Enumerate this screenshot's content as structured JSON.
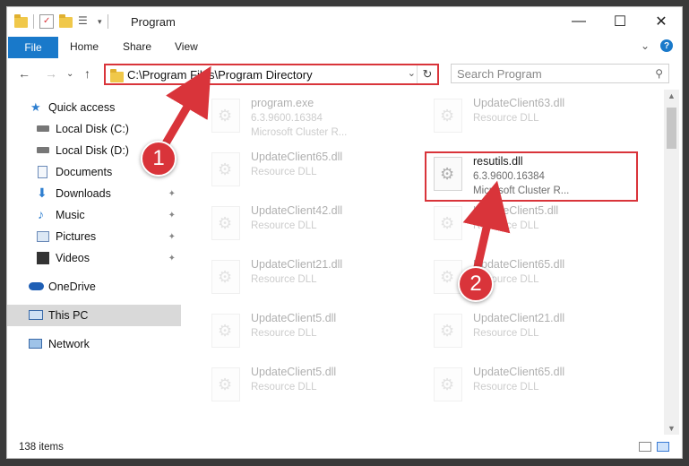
{
  "window": {
    "title": "Program",
    "minimize": "—",
    "maximize": "☐",
    "close": "✕"
  },
  "ribbon": {
    "tabs": [
      "File",
      "Home",
      "Share",
      "View"
    ],
    "expand": "⌄",
    "help": "?"
  },
  "nav": {
    "back": "←",
    "forward": "→",
    "recent": "⌄",
    "up": "↑",
    "address": "C:\\Program Files\\Program Directory",
    "address_dropdown": "⌄",
    "refresh": "↻",
    "search_placeholder": "Search Program",
    "search_icon": "⚲"
  },
  "sidebar": {
    "items": [
      {
        "label": "Quick access",
        "icon": "star-icon",
        "pinned": false
      },
      {
        "label": "Local Disk (C:)",
        "icon": "drive-icon",
        "pinned": false
      },
      {
        "label": "Local Disk (D:)",
        "icon": "drive-icon",
        "pinned": false
      },
      {
        "label": "Documents",
        "icon": "document-icon",
        "pinned": false
      },
      {
        "label": "Downloads",
        "icon": "download-icon",
        "pinned": true
      },
      {
        "label": "Music",
        "icon": "music-icon",
        "pinned": true
      },
      {
        "label": "Pictures",
        "icon": "picture-icon",
        "pinned": true
      },
      {
        "label": "Videos",
        "icon": "video-icon",
        "pinned": true
      },
      {
        "label": "OneDrive",
        "icon": "cloud-icon",
        "pinned": false
      },
      {
        "label": "This PC",
        "icon": "computer-icon",
        "pinned": false,
        "selected": true
      },
      {
        "label": "Network",
        "icon": "network-icon",
        "pinned": false
      }
    ],
    "pin_glyph": "📌"
  },
  "files": [
    {
      "name": "program.exe",
      "line2": "6.3.9600.16384",
      "line3": "Microsoft Cluster R...",
      "faded": true
    },
    {
      "name": "UpdateClient63.dll",
      "line2": "Resource DLL",
      "line3": "",
      "faded": true
    },
    {
      "name": "UpdateClient65.dll",
      "line2": "Resource DLL",
      "line3": "",
      "faded": true
    },
    {
      "name": "resutils.dll",
      "line2": "6.3.9600.16384",
      "line3": "Microsoft Cluster R...",
      "faded": false
    },
    {
      "name": "UpdateClient42.dll",
      "line2": "Resource DLL",
      "line3": "",
      "faded": true
    },
    {
      "name": "UpdateClient5.dll",
      "line2": "Resource DLL",
      "line3": "",
      "faded": true
    },
    {
      "name": "UpdateClient21.dll",
      "line2": "Resource DLL",
      "line3": "",
      "faded": true
    },
    {
      "name": "UpdateClient65.dll",
      "line2": "Resource DLL",
      "line3": "",
      "faded": true
    },
    {
      "name": "UpdateClient5.dll",
      "line2": "Resource DLL",
      "line3": "",
      "faded": true
    },
    {
      "name": "UpdateClient21.dll",
      "line2": "Resource DLL",
      "line3": "",
      "faded": true
    },
    {
      "name": "UpdateClient5.dll",
      "line2": "Resource DLL",
      "line3": "",
      "faded": true
    },
    {
      "name": "UpdateClient65.dll",
      "line2": "Resource DLL",
      "line3": "",
      "faded": true
    }
  ],
  "status": {
    "item_count": "138 items"
  },
  "callouts": [
    "1",
    "2"
  ],
  "colors": {
    "accent": "#1979ca",
    "highlight": "#d9343a"
  }
}
